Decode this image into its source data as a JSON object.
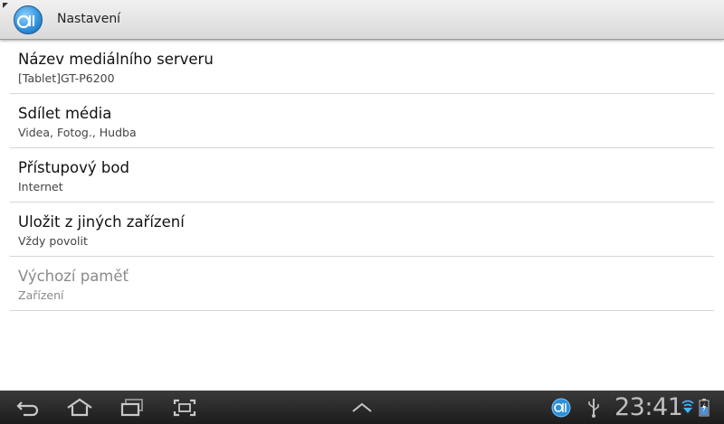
{
  "action_bar": {
    "title": "Nastavení",
    "app_icon": "allshare-icon"
  },
  "settings": [
    {
      "title": "Název mediálního serveru",
      "summary": "[Tablet]GT-P6200",
      "enabled": true
    },
    {
      "title": "Sdílet média",
      "summary": "Videa, Fotog., Hudba",
      "enabled": true
    },
    {
      "title": "Přístupový bod",
      "summary": "Internet",
      "enabled": true
    },
    {
      "title": "Uložit z jiných zařízení",
      "summary": "Vždy povolit",
      "enabled": true
    },
    {
      "title": "Výchozí paměť",
      "summary": "Zařízení",
      "enabled": false
    }
  ],
  "system_bar": {
    "buttons": [
      "back-icon",
      "home-icon",
      "recent-apps-icon",
      "screenshot-icon",
      "expand-up-icon"
    ],
    "status_icons": [
      "allshare-notification-icon",
      "usb-icon",
      "wifi-icon",
      "battery-icon"
    ],
    "time": "23:41"
  },
  "colors": {
    "accent": "#2e8fd8",
    "system_bar": "#1c1c1c",
    "divider": "#d6d6d6"
  }
}
